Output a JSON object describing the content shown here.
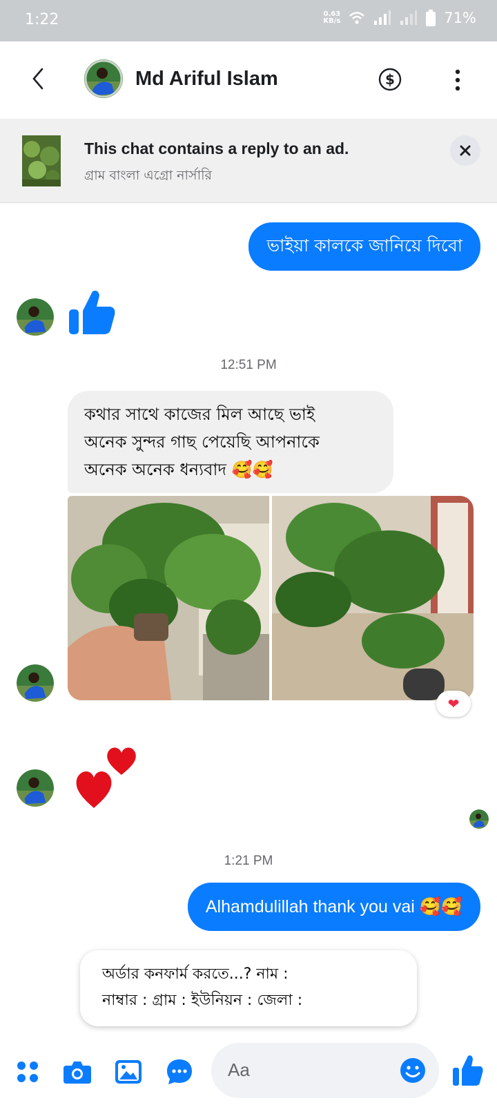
{
  "status_bar": {
    "time": "1:22",
    "net_speed_value": "0.63",
    "net_speed_unit": "KB/s",
    "battery": "71%"
  },
  "header": {
    "contact_name": "Md Ariful Islam",
    "icons": [
      "back-icon",
      "dollar-icon",
      "more-icon"
    ]
  },
  "ad_banner": {
    "title": "This chat contains a reply to an ad.",
    "subtitle": "গ্রাম বাংলা এগ্রো নার্সারি"
  },
  "messages": [
    {
      "type": "outgoing",
      "text": "ভাইয়া কালকে জানিয়ে দিবো"
    },
    {
      "type": "incoming_sticker",
      "sticker": "thumbs-up"
    },
    {
      "type": "timestamp",
      "text": "12:51 PM"
    },
    {
      "type": "incoming",
      "lines": [
        "কথার সাথে কাজের মিল আছে ভাই",
        "অনেক সুন্দর গাছ পেয়েছি আপনাকে",
        "অনেক অনেক ধন্যবাদ 🥰🥰"
      ]
    },
    {
      "type": "incoming_photos",
      "count": 2,
      "reaction": "❤"
    },
    {
      "type": "incoming_sticker",
      "sticker": "hearts"
    },
    {
      "type": "timestamp",
      "text": "1:21 PM"
    },
    {
      "type": "outgoing",
      "text": "Alhamdulillah thank you vai 🥰🥰"
    }
  ],
  "suggestion": {
    "lines": [
      "অর্ডার কনফার্ম করতে...? নাম :",
      "নাম্বার : গ্রাম : ইউনিয়ন : জেলা :"
    ]
  },
  "composer": {
    "placeholder": "Aa",
    "icons": [
      "apps-icon",
      "camera-icon",
      "gallery-icon",
      "chat-bubble-icon",
      "emoji-icon",
      "like-icon"
    ]
  },
  "colors": {
    "accent": "#0a7cff",
    "incoming_bubble": "#f0f0f0",
    "status_bar": "#c9ccce",
    "heart": "#f02849"
  }
}
